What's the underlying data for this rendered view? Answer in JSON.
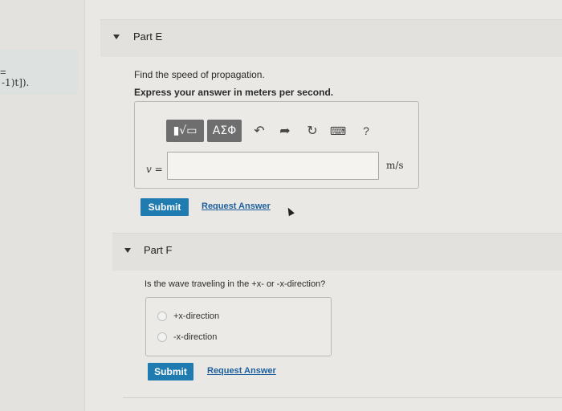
{
  "left_panel": {
    "eq_fragment": "=",
    "snippet": "-1)t])."
  },
  "part_e": {
    "title": "Part E",
    "question": "Find the speed of propagation.",
    "instruction": "Express your answer in meters per second.",
    "toolbar": {
      "template_label": "▮√▭",
      "greek_label": "ΑΣΦ",
      "undo_icon": "↶",
      "redo_icon": "➦",
      "reset_icon": "↻",
      "keyboard_icon": "⌨",
      "help_label": "?"
    },
    "variable_label": "v =",
    "input_value": "",
    "unit": "m/s",
    "submit_label": "Submit",
    "request_label": "Request Answer"
  },
  "part_f": {
    "title": "Part F",
    "question": "Is the wave traveling in the +x- or -x-direction?",
    "choices": [
      "+x-direction",
      "-x-direction"
    ],
    "submit_label": "Submit",
    "request_label": "Request Answer"
  }
}
